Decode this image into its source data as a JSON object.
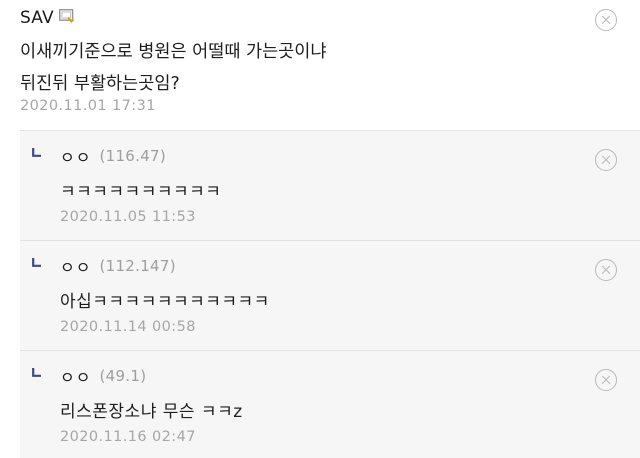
{
  "main_comment": {
    "nickname": "SAV",
    "member_icon": "member-badge-icon",
    "body_lines": [
      "이새끼기준으로 병원은 어떨때 가는곳이냐",
      "뒤진뒤 부활하는곳임?"
    ],
    "date": "2020.11.01 17:31"
  },
  "replies": [
    {
      "nickname": "ㅇㅇ",
      "ip": "(116.47)",
      "body": "ㅋㅋㅋㅋㅋㅋㅋㅋㅋㅋ",
      "date": "2020.11.05 11:53"
    },
    {
      "nickname": "ㅇㅇ",
      "ip": "(112.147)",
      "body": "아십ㅋㅋㅋㅋㅋㅋㅋㅋㅋㅋㅋ",
      "date": "2020.11.14 00:58"
    },
    {
      "nickname": "ㅇㅇ",
      "ip": "(49.1)",
      "body": "리스폰장소냐 무슨 ㅋㅋz",
      "date": "2020.11.16 02:47"
    }
  ],
  "colors": {
    "reply_background": "#f6f6f7",
    "divider": "#e2e2e4",
    "meta_text": "#a6a6a6",
    "reply_arrow": "#3a4a8c"
  },
  "icons": {
    "close": "close-circle-icon",
    "reply": "reply-arrow-icon"
  }
}
